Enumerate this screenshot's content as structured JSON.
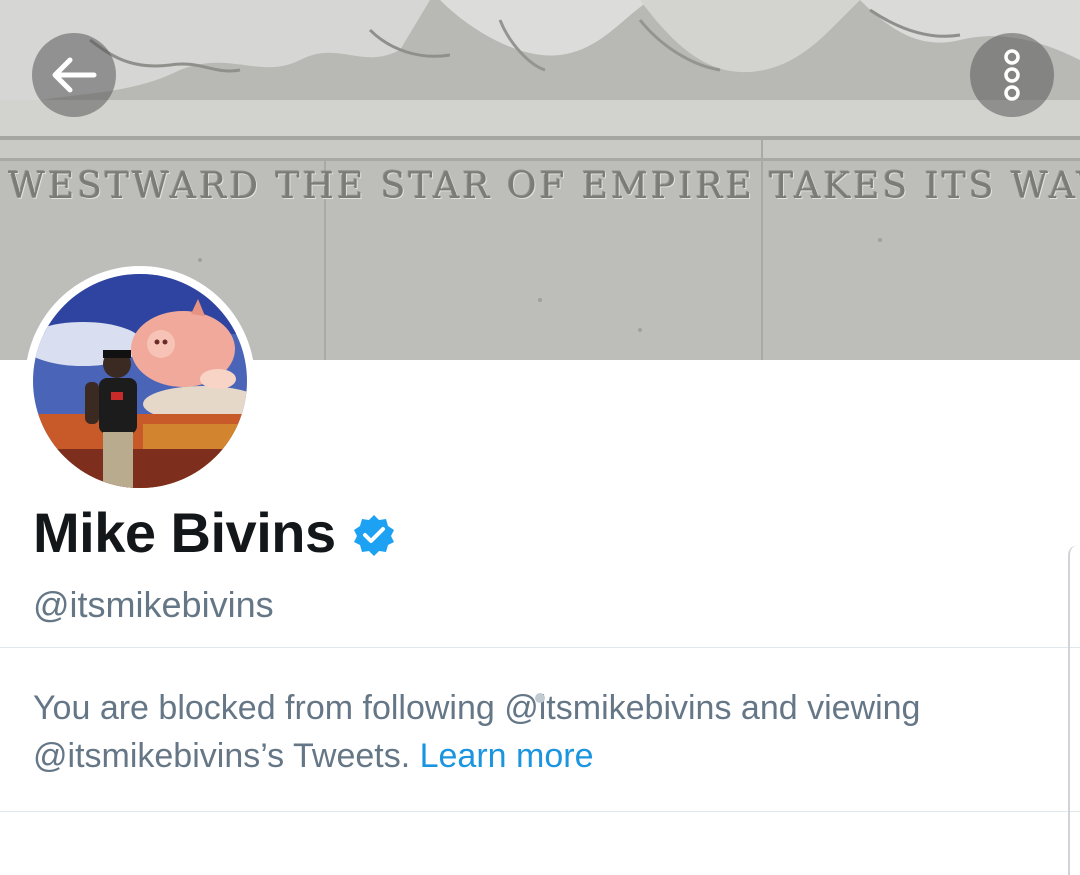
{
  "header": {
    "banner_inscription": "WESTWARD THE STAR OF EMPIRE TAKES ITS WAY",
    "back_icon": "arrow-left-icon",
    "more_icon": "more-vertical-icon"
  },
  "profile": {
    "display_name": "Mike Bivins",
    "handle": "@itsmikebivins",
    "verified": true,
    "verified_color": "#1da1f2"
  },
  "notice": {
    "text": "You are blocked from following @itsmikebivins and viewing @itsmikebivins’s Tweets.",
    "link_label": "Learn more",
    "link_color": "#1b95e0"
  }
}
